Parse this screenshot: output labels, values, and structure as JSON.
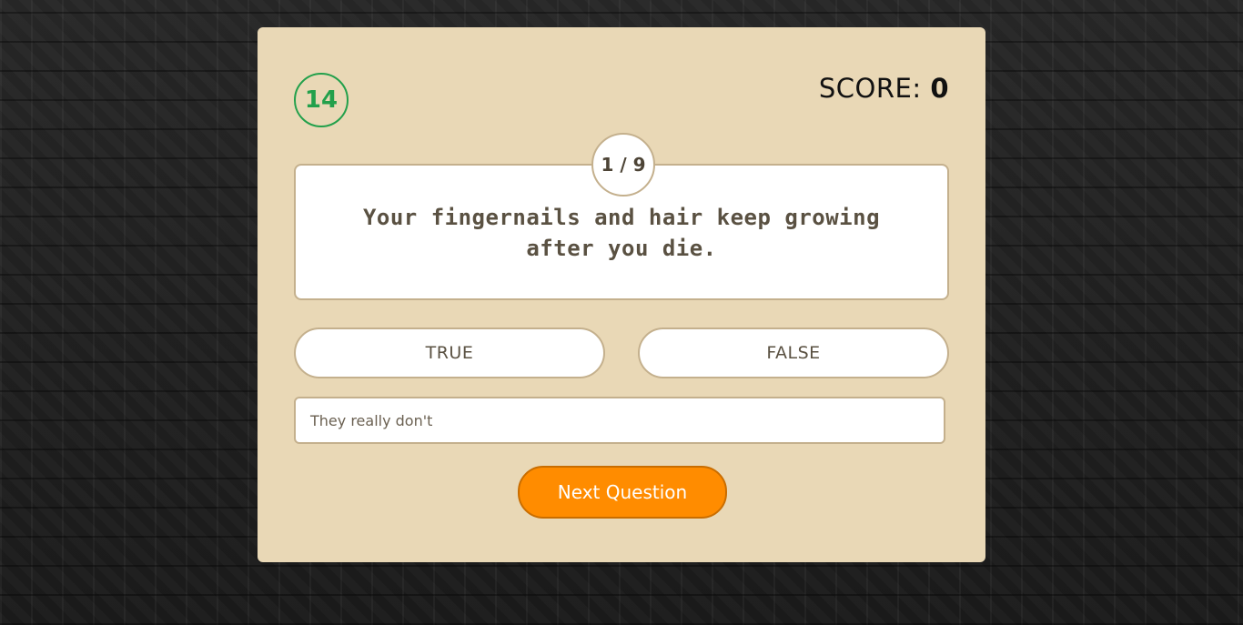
{
  "quiz": {
    "timer": "14",
    "score_label": "SCORE: ",
    "score_value": "0",
    "counter": "1 / 9",
    "question": "Your fingernails and hair keep growing after you die.",
    "answers": {
      "true_label": "TRUE",
      "false_label": "FALSE"
    },
    "explanation": "They really don't",
    "next_label": "Next Question"
  },
  "colors": {
    "card_background": "#e9d8b6",
    "timer_green": "#22a04b",
    "next_button_orange": "#ff8c00",
    "border_tan": "#c4b08d"
  }
}
